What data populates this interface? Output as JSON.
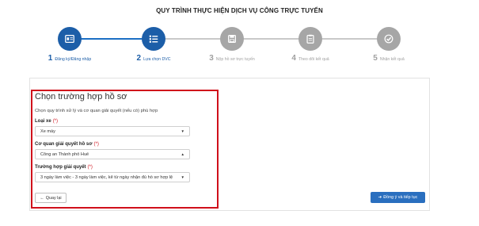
{
  "page_title": "QUY TRÌNH THỰC HIỆN DỊCH VỤ CÔNG TRỰC TUYẾN",
  "steps": [
    {
      "number": "1",
      "label": "Đăng ký/Đăng nhập",
      "state": "done",
      "icon": "id-card-icon"
    },
    {
      "number": "2",
      "label": "Lựa chọn DVC",
      "state": "current",
      "icon": "list-icon"
    },
    {
      "number": "3",
      "label": "Nộp hồ sơ trực tuyến",
      "state": "pending",
      "icon": "save-icon"
    },
    {
      "number": "4",
      "label": "Theo dõi kết quả",
      "state": "pending",
      "icon": "clipboard-icon"
    },
    {
      "number": "5",
      "label": "Nhận kết quả",
      "state": "pending",
      "icon": "check-icon"
    }
  ],
  "form": {
    "title": "Chọn trường hợp hồ sơ",
    "description": "Chọn quy trình xử lý và cơ quan giải quyết (nếu có) phù hợp",
    "required_mark": "(*)",
    "fields": [
      {
        "label": "Loại xe",
        "value": "Xe máy"
      },
      {
        "label": "Cơ quan giải quyết hồ sơ",
        "value": "Công an Thành phố Huế"
      },
      {
        "label": "Trường hợp giải quyết",
        "value": "3 ngày làm việc - 3 ngày làm việc, kể từ ngày nhận đủ hồ sơ hợp lệ"
      }
    ]
  },
  "buttons": {
    "back_label": "Quay lại",
    "next_label": "Đồng ý và tiếp tục"
  },
  "colors": {
    "accent": "#1c5ea8",
    "highlight_border": "#d0101b",
    "inactive": "#a6a6a6",
    "primary_button": "#2a6fbf"
  }
}
